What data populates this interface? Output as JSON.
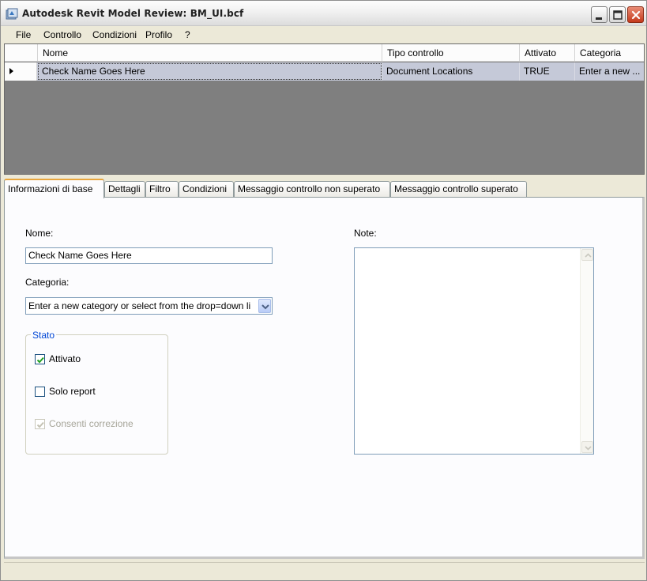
{
  "window": {
    "title": "Autodesk Revit Model Review: BM_UI.bcf"
  },
  "menu": {
    "items": [
      "File",
      "Controllo",
      "Condizioni",
      "Profilo",
      "?"
    ]
  },
  "grid": {
    "columns": [
      "Nome",
      "Tipo controllo",
      "Attivato",
      "Categoria"
    ],
    "rows": [
      {
        "nome": "Check Name Goes Here",
        "tipo_controllo": "Document Locations",
        "attivato": "TRUE",
        "categoria": "Enter a new ..."
      }
    ]
  },
  "tabs": [
    "Informazioni di base",
    "Dettagli",
    "Filtro",
    "Condizioni",
    "Messaggio controllo non superato",
    "Messaggio controllo superato"
  ],
  "form": {
    "nome_label": "Nome:",
    "nome_value": "Check Name Goes Here",
    "categoria_label": "Categoria:",
    "categoria_value": "Enter a new category or select from the drop=down li",
    "note_label": "Note:",
    "note_value": "",
    "stato": {
      "title": "Stato",
      "attivato": {
        "label": "Attivato",
        "checked": true,
        "enabled": true
      },
      "solo_report": {
        "label": "Solo report",
        "checked": false,
        "enabled": true
      },
      "consenti_correzione": {
        "label": "Consenti correzione",
        "checked": true,
        "enabled": false
      }
    }
  },
  "colors": {
    "selected_row": "#c5c9d8",
    "grid_background": "#7f7f7f",
    "active_tab_accent": "#e8a53c",
    "group_title": "#0046d5"
  }
}
